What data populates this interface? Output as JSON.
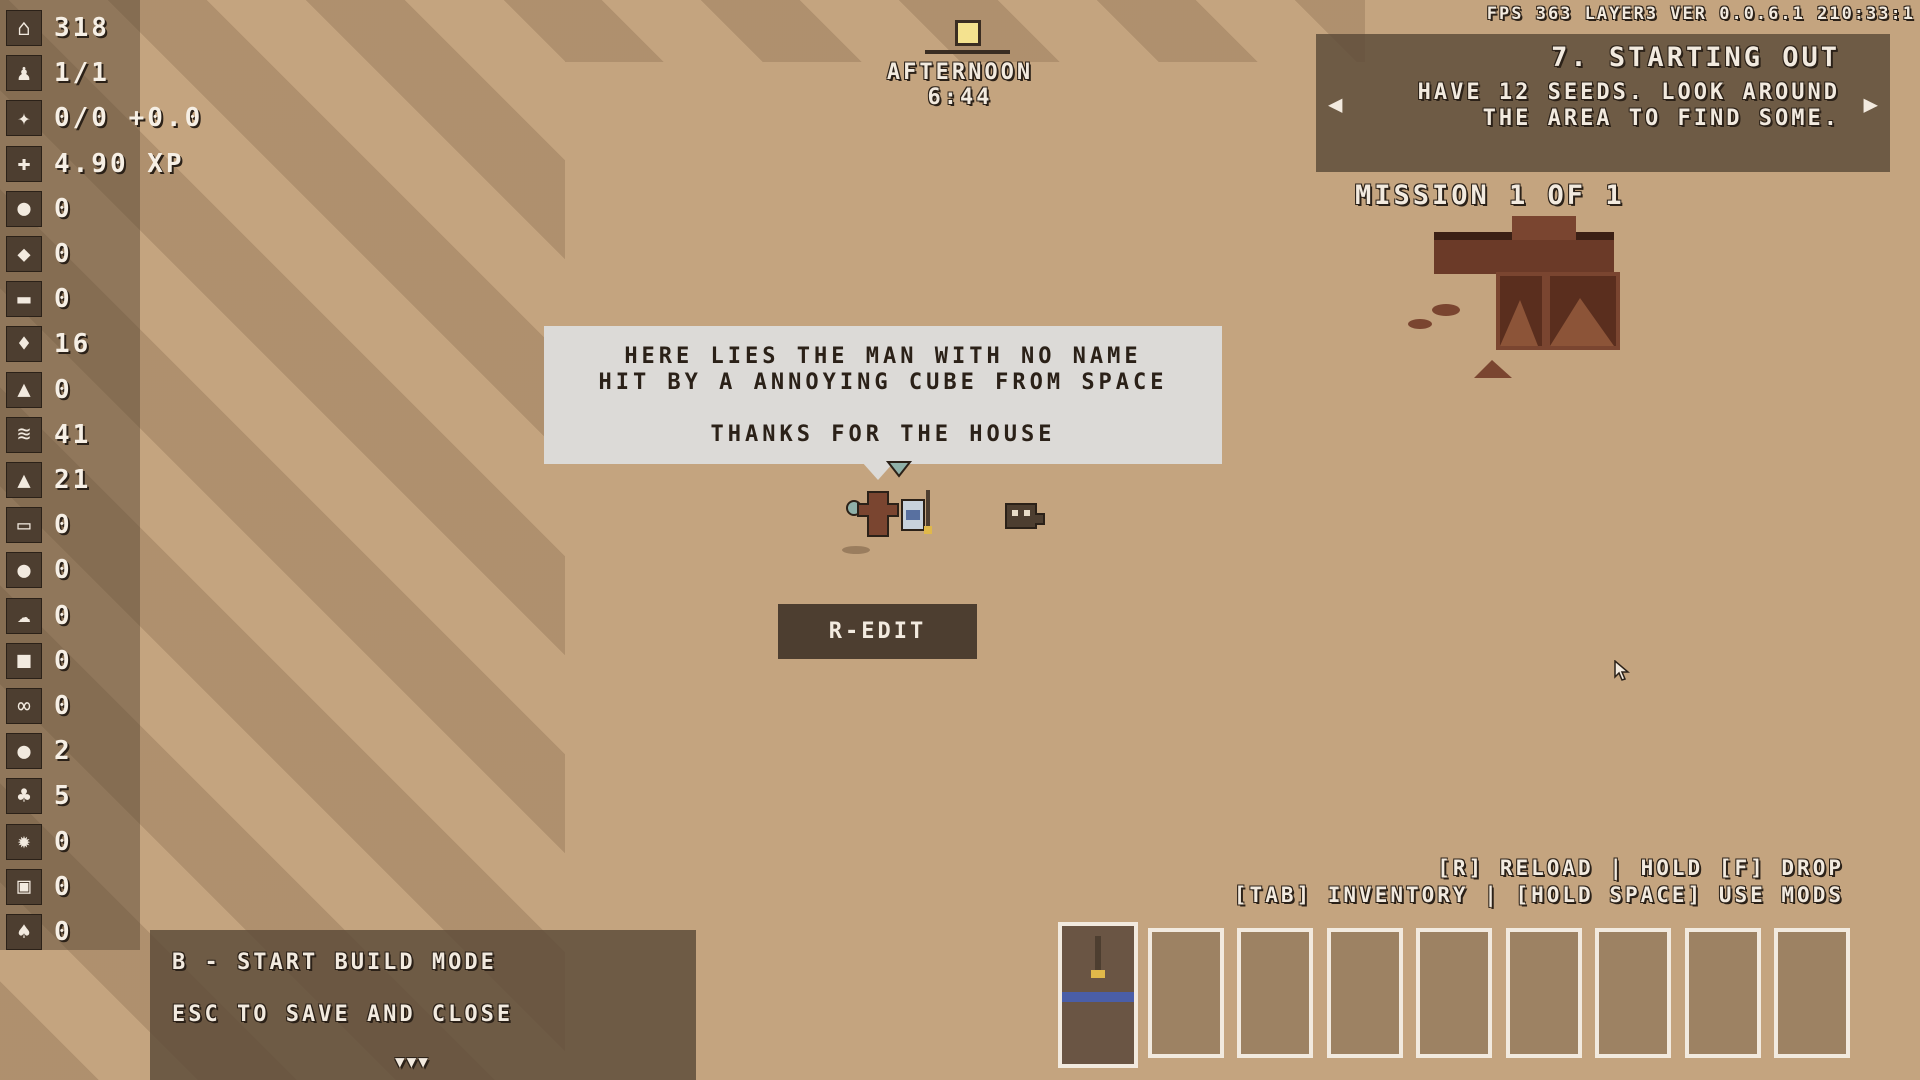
{
  "resources": [
    {
      "icon": "house-icon",
      "glyph": "⌂",
      "value": "318"
    },
    {
      "icon": "person-icon",
      "glyph": "♟",
      "value": "1/1"
    },
    {
      "icon": "sparkle-icon",
      "glyph": "✦",
      "value": "0/0 +0.0"
    },
    {
      "icon": "xp-icon",
      "glyph": "✚",
      "value": "4.90 XP"
    },
    {
      "icon": "coin-icon",
      "glyph": "●",
      "value": "0"
    },
    {
      "icon": "meat-icon",
      "glyph": "◆",
      "value": "0"
    },
    {
      "icon": "corn-icon",
      "glyph": "▬",
      "value": "0"
    },
    {
      "icon": "water-drop-icon",
      "glyph": "♦",
      "value": "16"
    },
    {
      "icon": "dirt-pile-icon",
      "glyph": "▲",
      "value": "0"
    },
    {
      "icon": "wood-icon",
      "glyph": "≋",
      "value": "41"
    },
    {
      "icon": "stone-icon",
      "glyph": "▲",
      "value": "21"
    },
    {
      "icon": "plank-icon",
      "glyph": "▭",
      "value": "0"
    },
    {
      "icon": "pink-orb-icon",
      "glyph": "●",
      "value": "0"
    },
    {
      "icon": "cloud-icon",
      "glyph": "☁",
      "value": "0"
    },
    {
      "icon": "leather-icon",
      "glyph": "■",
      "value": "0"
    },
    {
      "icon": "rope-icon",
      "glyph": "∞",
      "value": "0"
    },
    {
      "icon": "acorn-icon",
      "glyph": "●",
      "value": "2"
    },
    {
      "icon": "leaf-icon",
      "glyph": "♣",
      "value": "5"
    },
    {
      "icon": "gear-icon",
      "glyph": "✹",
      "value": "0"
    },
    {
      "icon": "chip-icon",
      "glyph": "▣",
      "value": "0"
    },
    {
      "icon": "seed-icon",
      "glyph": "♠",
      "value": "0"
    }
  ],
  "time": {
    "period": "AFTERNOON",
    "clock": "6:44"
  },
  "status_bar": "FPS 363 LAYER3  VER 0.0.6.1  210:33:1",
  "quest": {
    "title": "7. STARTING OUT",
    "description": "HAVE 12 SEEDS. LOOK AROUND THE AREA TO FIND SOME.",
    "mission_count": "MISSION 1 OF 1"
  },
  "gravestone": {
    "line1": "HERE LIES THE MAN WITH NO NAME",
    "line2": "HIT BY A ANNOYING CUBE FROM SPACE",
    "line3": "THANKS FOR THE HOUSE"
  },
  "edit_button": "R-EDIT",
  "controls": {
    "line1": "[R] RELOAD | HOLD [F] DROP",
    "line2": "[TAB] INVENTORY | [HOLD SPACE] USE MODS"
  },
  "hotbar": {
    "slot_count": 9,
    "selected_index": 0,
    "selected_item_icon": "torch-icon"
  },
  "build_panel": {
    "line1": "B - START BUILD MODE",
    "line2": "ESC TO SAVE AND CLOSE",
    "more": "▼▼▼"
  },
  "colors": {
    "ground": "#c4a47f",
    "panel": "#5c4a38",
    "text": "#f2eadf",
    "dialog_bg": "#dcdad7",
    "ruin": "#6b3a28"
  }
}
